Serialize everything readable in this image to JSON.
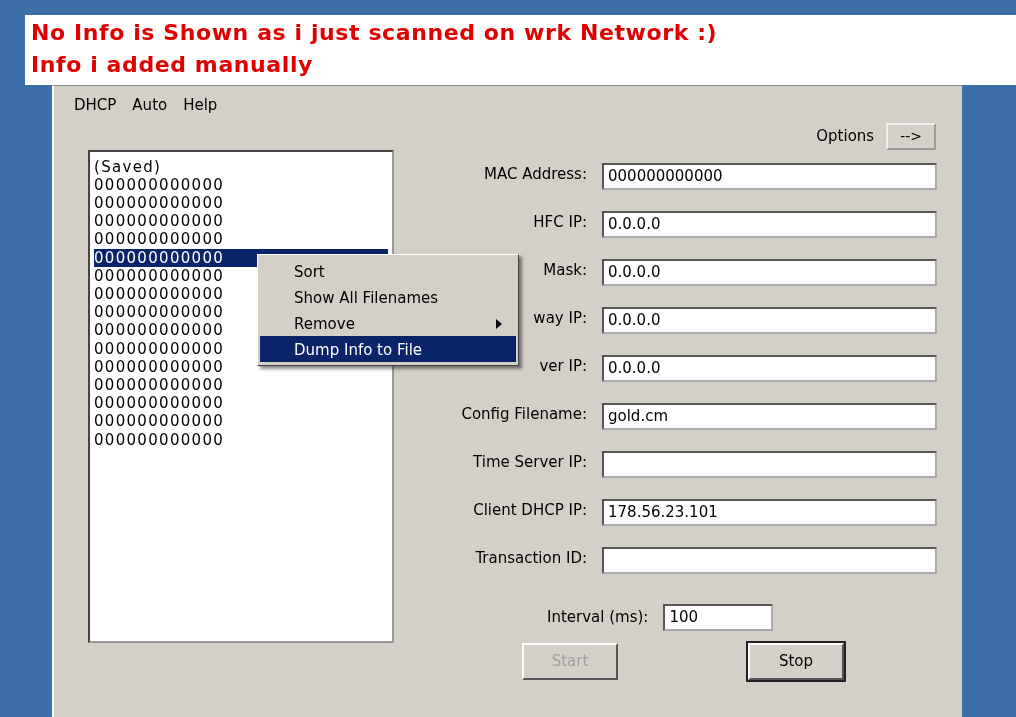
{
  "banner": {
    "lines": [
      "No Info is Shown as i just scanned on wrk Network :)",
      "Info i added manually"
    ]
  },
  "menu": [
    "DHCP",
    "Auto",
    "Help"
  ],
  "options": {
    "label": "Options",
    "button": "-->"
  },
  "list": {
    "items": [
      {
        "text": "(Saved)",
        "selected": false
      },
      {
        "text": "000000000000",
        "selected": false
      },
      {
        "text": "000000000000",
        "selected": false
      },
      {
        "text": "000000000000",
        "selected": false
      },
      {
        "text": "000000000000",
        "selected": false
      },
      {
        "text": "000000000000",
        "selected": true
      },
      {
        "text": "000000000000",
        "selected": false
      },
      {
        "text": "000000000000",
        "selected": false
      },
      {
        "text": "000000000000",
        "selected": false
      },
      {
        "text": "000000000000",
        "selected": false
      },
      {
        "text": "000000000000",
        "selected": false
      },
      {
        "text": "000000000000",
        "selected": false
      },
      {
        "text": "000000000000",
        "selected": false
      },
      {
        "text": "000000000000",
        "selected": false
      },
      {
        "text": "000000000000",
        "selected": false
      },
      {
        "text": "000000000000",
        "selected": false
      }
    ]
  },
  "context_menu": [
    {
      "label": "Sort",
      "submenu": false,
      "selected": false
    },
    {
      "label": "Show All Filenames",
      "submenu": false,
      "selected": false
    },
    {
      "label": "Remove",
      "submenu": true,
      "selected": false
    },
    {
      "label": "Dump Info to File",
      "submenu": false,
      "selected": true
    }
  ],
  "fields": [
    {
      "label": "MAC Address:",
      "value": "000000000000"
    },
    {
      "label": "HFC IP:",
      "value": "0.0.0.0"
    },
    {
      "label": "Mask:",
      "value": "0.0.0.0"
    },
    {
      "label": "way IP:",
      "value": "0.0.0.0"
    },
    {
      "label": "ver IP:",
      "value": "0.0.0.0"
    },
    {
      "label": "Config Filename:",
      "value": "gold.cm"
    },
    {
      "label": "Time Server IP:"
    },
    {
      "label": "Client DHCP IP:",
      "value": "178.56.23.101"
    },
    {
      "label": "Transaction ID:"
    }
  ],
  "interval": {
    "label": "Interval (ms):",
    "value": "100"
  },
  "buttons": [
    {
      "label": "Start",
      "disabled": true
    },
    {
      "label": "Stop",
      "disabled": false
    }
  ]
}
